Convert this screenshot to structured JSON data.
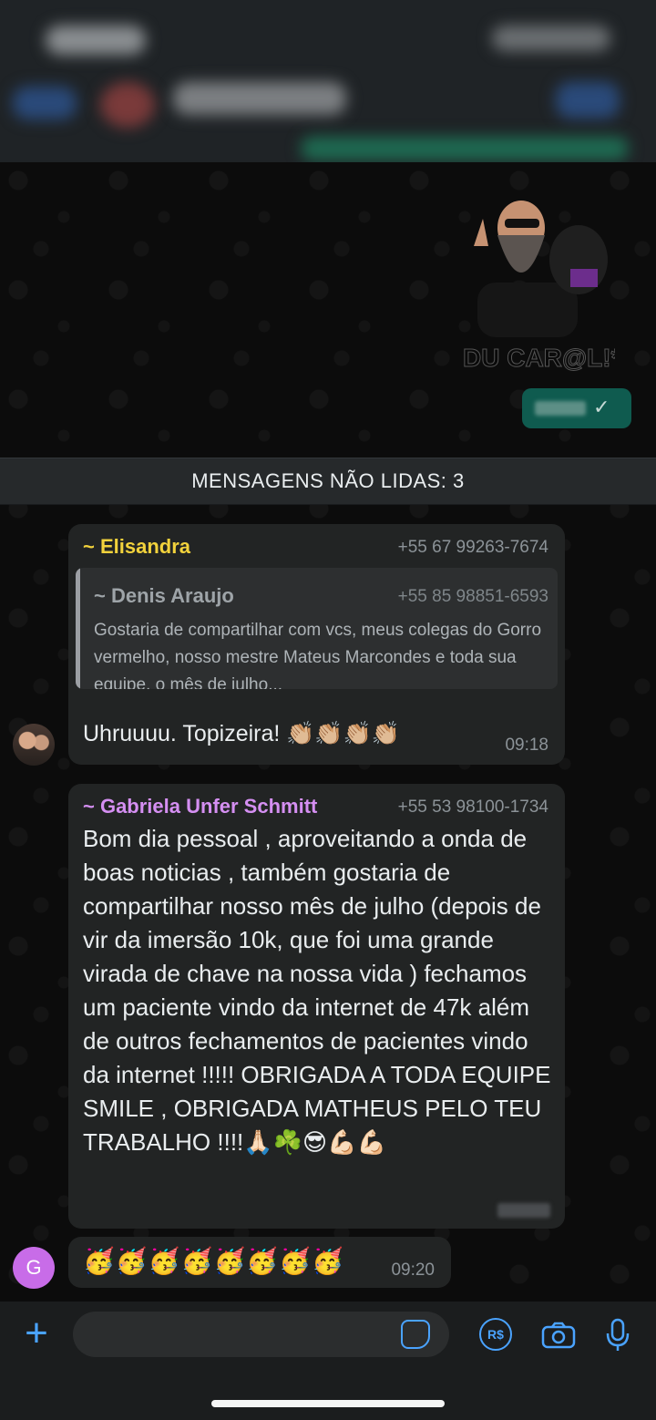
{
  "header": {},
  "unread_divider": "MENSAGENS NÃO LIDAS: 3",
  "sticker_caption": "DU CAR@L!*",
  "messages": [
    {
      "sender": "~ Elisandra",
      "phone": "+55 67 99263-7674",
      "quote": {
        "sender": "~ Denis Araujo",
        "phone": "+55 85 98851-6593",
        "text": "Gostaria de compartilhar com vcs, meus colegas do Gorro vermelho, nosso mestre Mateus Marcondes e toda sua equipe, o mês de julho..."
      },
      "text": "Uhruuuu. Topizeira! 👏🏼👏🏼👏🏼👏🏼",
      "time": "09:18"
    },
    {
      "sender": "~ Gabriela Unfer Schmitt",
      "phone": "+55 53 98100-1734",
      "text": "Bom dia pessoal , aproveitando a onda de boas noticias , também gostaria de compartilhar nosso mês de julho (depois de vir da  imersão 10k, que  foi uma grande  virada de chave na nossa vida ) fechamos um paciente vindo da internet de 47k  além de outros fechamentos de pacientes vindo da internet !!!!! OBRIGADA A TODA EQUIPE SMILE , OBRIGADA MATHEUS PELO TEU TRABALHO !!!!🙏🏻☘️😎💪🏻💪🏻"
    },
    {
      "text": "🥳🥳🥳🥳🥳🥳🥳🥳",
      "time": "09:20"
    }
  ],
  "avatar_letter": "G",
  "input": {
    "placeholder": ""
  },
  "icons": [
    "plus-icon",
    "sticker-icon",
    "pix-rs-icon",
    "camera-icon",
    "microphone-icon"
  ]
}
